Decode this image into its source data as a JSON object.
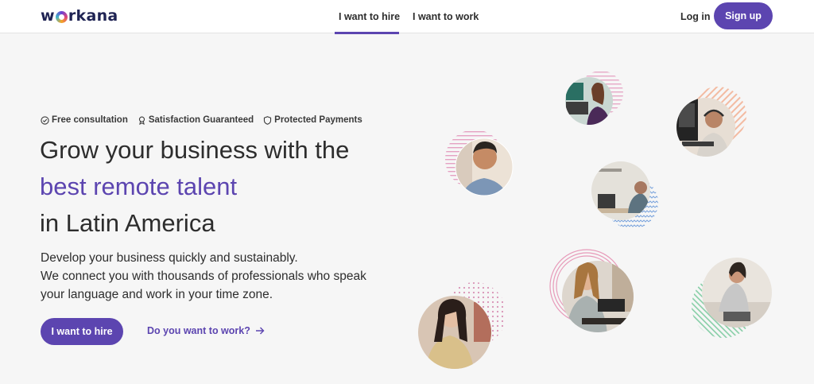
{
  "header": {
    "logo": {
      "prefix": "w",
      "suffix": "rkana"
    },
    "tabs": [
      {
        "label": "I want to hire",
        "active": true
      },
      {
        "label": "I want to work",
        "active": false
      }
    ],
    "login_label": "Log in",
    "signup_label": "Sign up"
  },
  "hero": {
    "features": [
      "Free consultation",
      "Satisfaction Guaranteed",
      "Protected Payments"
    ],
    "headline": [
      "Grow your business with the",
      "best remote talent",
      "in Latin America"
    ],
    "subtext": [
      "Develop your business quickly and sustainably.",
      "We connect you with thousands of professionals who speak",
      "your language and work in your time zone."
    ],
    "primary_cta": "I want to hire",
    "secondary_cta": "Do you want to work?"
  },
  "colors": {
    "brand_purple": "#5c45b0",
    "logo_navy": "#1f2353",
    "page_background": "#f6f6f6"
  },
  "icons": [
    "check-circle-icon",
    "award-icon",
    "shield-icon",
    "arrow-right-icon"
  ]
}
